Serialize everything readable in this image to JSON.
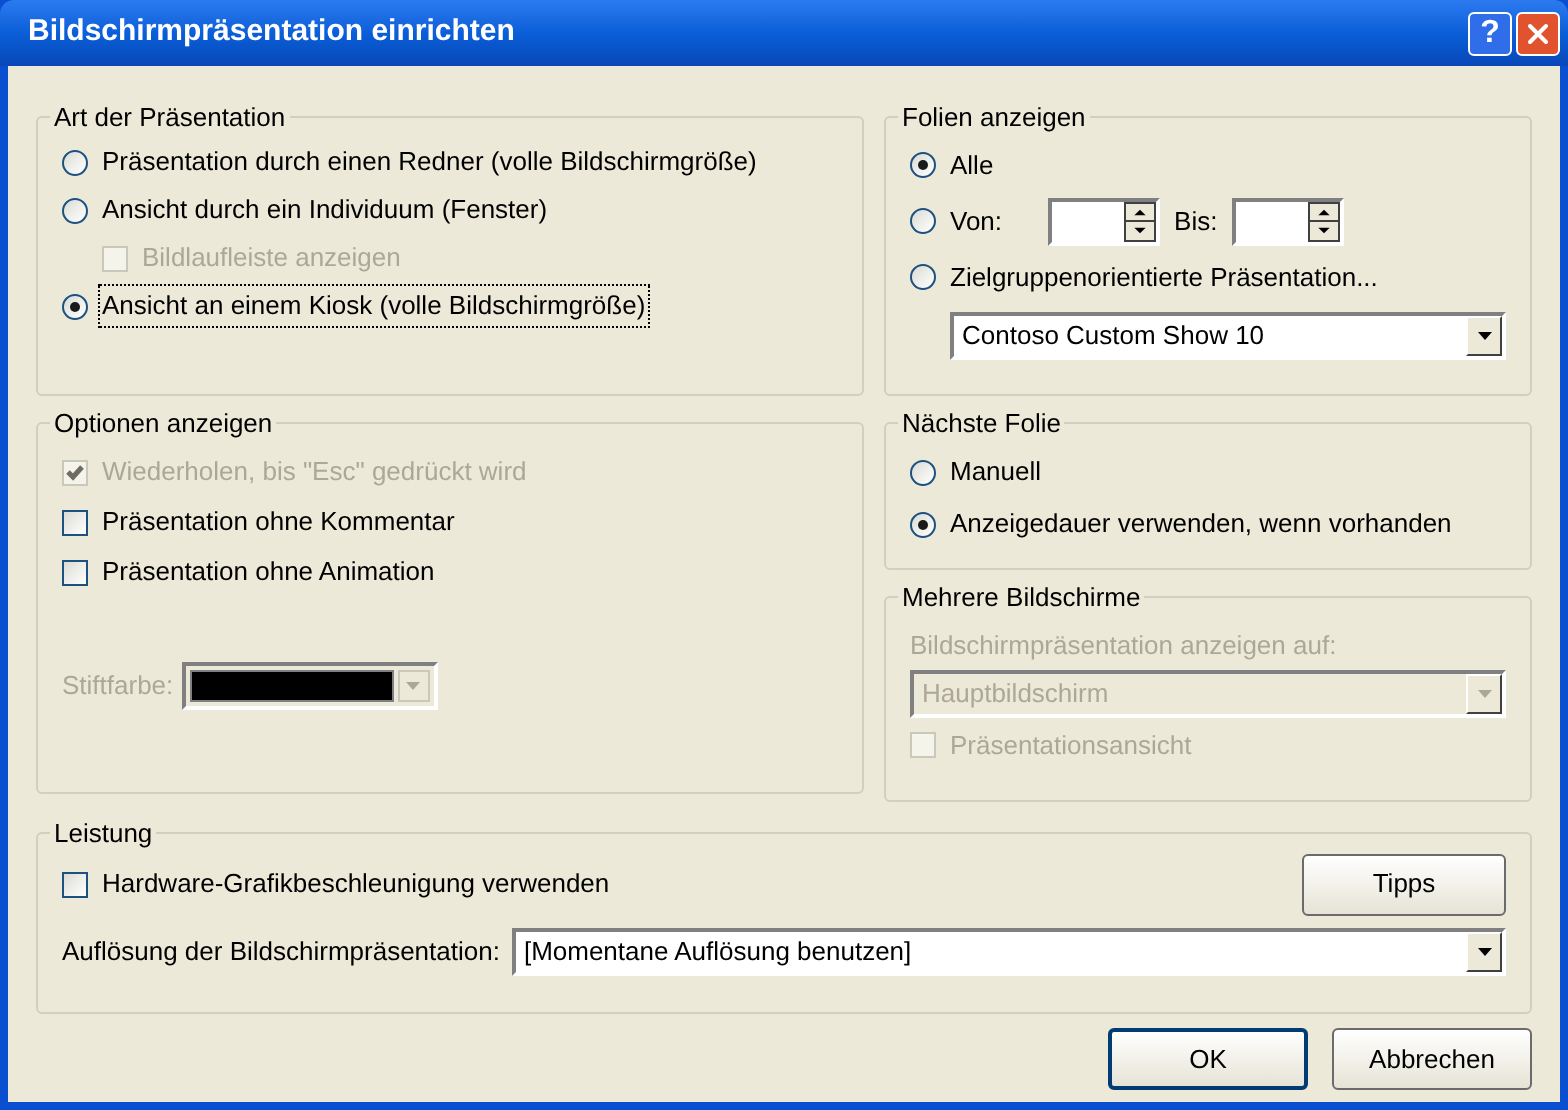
{
  "window": {
    "title": "Bildschirmpräsentation einrichten",
    "help_button": "?"
  },
  "presentation_type": {
    "title": "Art der Präsentation",
    "items": [
      {
        "kind": "radio",
        "label": "Präsentation durch einen Redner (volle Bildschirmgröße)",
        "selected": false,
        "disabled": false,
        "focused": false
      },
      {
        "kind": "radio",
        "label": "Ansicht durch ein Individuum (Fenster)",
        "selected": false,
        "disabled": false,
        "focused": false
      },
      {
        "kind": "checkbox",
        "label": "Bildlaufleiste anzeigen",
        "checked": false,
        "disabled": true,
        "focused": false
      },
      {
        "kind": "radio",
        "label": "Ansicht an einem Kiosk (volle Bildschirmgröße)",
        "selected": true,
        "disabled": false,
        "focused": true
      }
    ]
  },
  "show_options": {
    "title": "Optionen anzeigen",
    "items": [
      {
        "label": "Wiederholen, bis \"Esc\" gedrückt wird",
        "checked": true,
        "disabled": true
      },
      {
        "label": "Präsentation ohne Kommentar",
        "checked": false,
        "disabled": false
      },
      {
        "label": "Präsentation ohne Animation",
        "checked": false,
        "disabled": false
      }
    ],
    "pen_color": {
      "label": "Stiftfarbe:",
      "disabled": true
    }
  },
  "slides": {
    "title": "Folien anzeigen",
    "items": [
      {
        "kind": "radio",
        "label": "Alle",
        "selected": true
      },
      {
        "kind": "range",
        "label": "Von:",
        "to_label": "Bis:",
        "selected": false
      },
      {
        "kind": "radio",
        "label": "Zielgruppenorientierte Präsentation...",
        "selected": false
      }
    ],
    "custom_show": {
      "value": "Contoso Custom Show 10",
      "disabled": false
    }
  },
  "next_slide": {
    "title": "Nächste Folie",
    "items": [
      {
        "label": "Manuell",
        "selected": false
      },
      {
        "label": "Anzeigedauer verwenden, wenn vorhanden",
        "selected": true
      }
    ]
  },
  "monitors": {
    "title": "Mehrere Bildschirme",
    "label": "Bildschirmpräsentation anzeigen auf:",
    "dropdown": {
      "value": "Hauptbildschirm",
      "disabled": true
    },
    "checkbox": {
      "label": "Präsentationsansicht",
      "checked": false,
      "disabled": true
    }
  },
  "performance": {
    "title": "Leistung",
    "checkbox": {
      "label": "Hardware-Grafikbeschleunigung verwenden",
      "checked": false,
      "disabled": false
    },
    "tips_button": "Tipps",
    "resolution": {
      "label": "Auflösung der Bildschirmpräsentation:",
      "value": "[Momentane Auflösung benutzen]"
    }
  },
  "buttons": [
    {
      "label": "OK",
      "default": true
    },
    {
      "label": "Abbrechen",
      "default": false
    }
  ]
}
